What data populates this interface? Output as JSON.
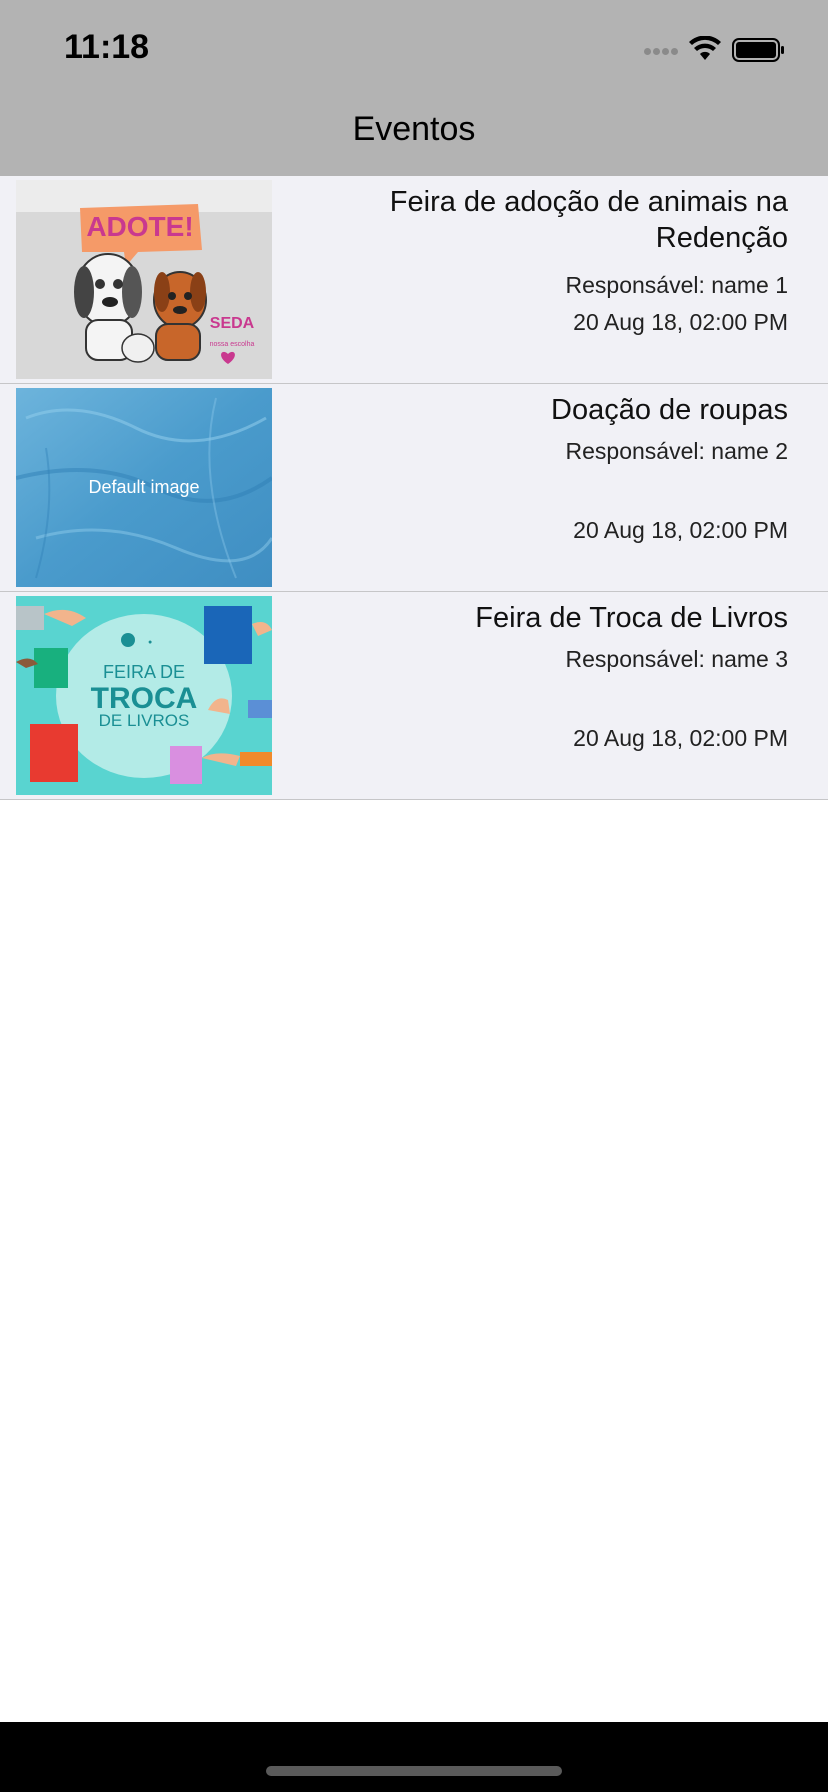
{
  "status_bar": {
    "time": "11:18",
    "icons": [
      "signal-icon",
      "wifi-icon",
      "battery-icon"
    ]
  },
  "nav": {
    "title": "Eventos"
  },
  "events": [
    {
      "title": "Feira de adoção de animais na Redenção",
      "responsible": "Responsável: name 1",
      "date": "20 Aug 18, 02:00 PM",
      "image": {
        "kind": "poster",
        "headline": "ADOTE!",
        "logo": "SEDA",
        "subline": "nossa escolha"
      }
    },
    {
      "title": "Doação de roupas",
      "responsible": "Responsável: name 2",
      "date": "20 Aug 18, 02:00 PM",
      "image": {
        "kind": "default",
        "label": "Default image"
      }
    },
    {
      "title": "Feira de Troca de Livros",
      "responsible": "Responsável: name 3",
      "date": "20 Aug 18, 02:00 PM",
      "image": {
        "kind": "poster",
        "line1": "FEIRA DE",
        "line2": "TROCA",
        "line3": "DE LIVROS"
      }
    }
  ],
  "colors": {
    "header_bg": "#b3b3b3",
    "row_bg": "#f1f1f6",
    "separator": "#c6c6c8",
    "adote_orange": "#f59a68",
    "adote_magenta": "#c9398f",
    "troca_teal": "#59d4d0",
    "troca_text": "#1a8f94"
  }
}
